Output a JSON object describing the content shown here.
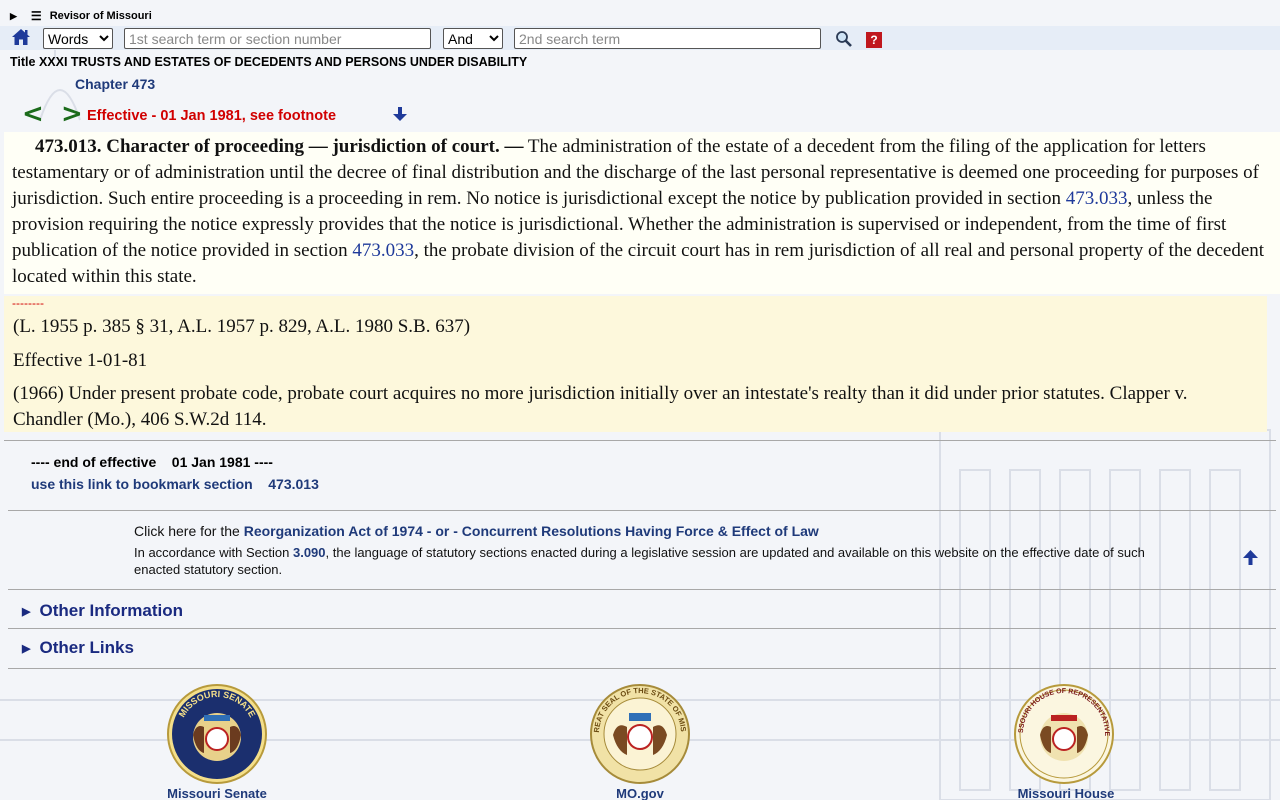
{
  "site": {
    "name": "Revisor of Missouri"
  },
  "search": {
    "mode_selected": "Words",
    "mode_options": [
      "Words"
    ],
    "term1_placeholder": "1st search term or section number",
    "operator_selected": "And",
    "operator_options": [
      "And"
    ],
    "term2_placeholder": "2nd search term",
    "help_label": "?"
  },
  "header": {
    "title": "Title XXXI TRUSTS AND ESTATES OF DECEDENTS AND PERSONS UNDER DISABILITY",
    "chapter": "Chapter 473",
    "prev": "<",
    "next": ">",
    "effective": "Effective - 01 Jan 1981, see footnote"
  },
  "statute": {
    "heading": "473.013.  Character of proceeding — jurisdiction of court. —",
    "text_1": " The administration of the estate of a decedent from the filing of the application for letters testamentary or of administration until the decree of final distribution and the discharge of the last personal representative is deemed one proceeding for purposes of jurisdiction.  Such entire proceeding is a proceeding in rem.  No notice is jurisdictional except the notice by publication provided in section ",
    "link_1": "473.033",
    "text_2": ", unless the provision requiring the notice expressly provides that the notice is jurisdictional.  Whether the administration is supervised or independent, from the time of first publication of the notice provided in section ",
    "link_2": "473.033",
    "text_3": ", the probate division of the circuit court has in rem jurisdiction of all real and personal property of the decedent located within this state."
  },
  "notes": {
    "dashes": "--------",
    "history": "(L. 1955 p. 385 § 31, A.L. 1957 p. 829, A.L. 1980 S.B. 637)",
    "effective": "Effective 1-01-81",
    "note_1966": "(1966) Under present probate code, probate court acquires no more jurisdiction initially over an intestate's realty than it did under prior statutes.  Clapper v. Chandler (Mo.), 406 S.W.2d 114."
  },
  "footer_info": {
    "end_effective": "---- end of effective    01 Jan 1981 ----",
    "bookmark": "use this link to bookmark section    473.013",
    "reorg_prefix": "Click here for the ",
    "reorg_link": "Reorganization Act of 1974 - or - Concurrent Resolutions Having Force & Effect of Law",
    "accord_prefix": "In accordance with Section ",
    "accord_link": "3.090",
    "accord_suffix": ", the language of statutory sections enacted during a legislative session are updated and available on this website on the effective date of such enacted statutory section."
  },
  "disclosures": {
    "other_information": "Other Information",
    "other_links": "Other Links"
  },
  "seals": {
    "senate": "Missouri Senate",
    "mogov": "MO.gov",
    "house": "Missouri House",
    "senate_ring": "MISSOURI SENATE",
    "state_ring": "THE GREAT SEAL OF THE STATE OF MISSOURI",
    "house_ring": "MISSOURI HOUSE OF REPRESENTATIVES"
  },
  "colors": {
    "link_blue": "#1f3a7a",
    "effective_red": "#d10000",
    "nav_green": "#1b6b1b",
    "statute_bg": "#fffff6",
    "notes_bg": "#fdf8dc"
  }
}
